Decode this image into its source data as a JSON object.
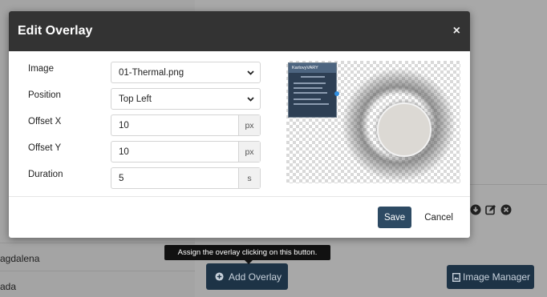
{
  "modal": {
    "title": "Edit Overlay",
    "close_glyph": "×",
    "fields": {
      "image": {
        "label": "Image",
        "value": "01-Thermal.png"
      },
      "position": {
        "label": "Position",
        "value": "Top Left"
      },
      "offset_x": {
        "label": "Offset X",
        "value": "10",
        "unit": "px"
      },
      "offset_y": {
        "label": "Offset Y",
        "value": "10",
        "unit": "px"
      },
      "duration": {
        "label": "Duration",
        "value": "5",
        "unit": "s"
      }
    },
    "preview": {
      "thumb_brand": "KarlovyVARY"
    },
    "footer": {
      "save_label": "Save",
      "cancel_label": "Cancel"
    }
  },
  "background": {
    "list_names": [
      "agdalena",
      "ada"
    ],
    "add_overlay_label": "Add Overlay",
    "image_manager_label": "Image Manager",
    "tooltip": "Assign the overlay clicking on this button."
  },
  "colors": {
    "header_bg": "#333333",
    "save_bg": "#2d4a63",
    "bg_button": "#1d3346"
  }
}
